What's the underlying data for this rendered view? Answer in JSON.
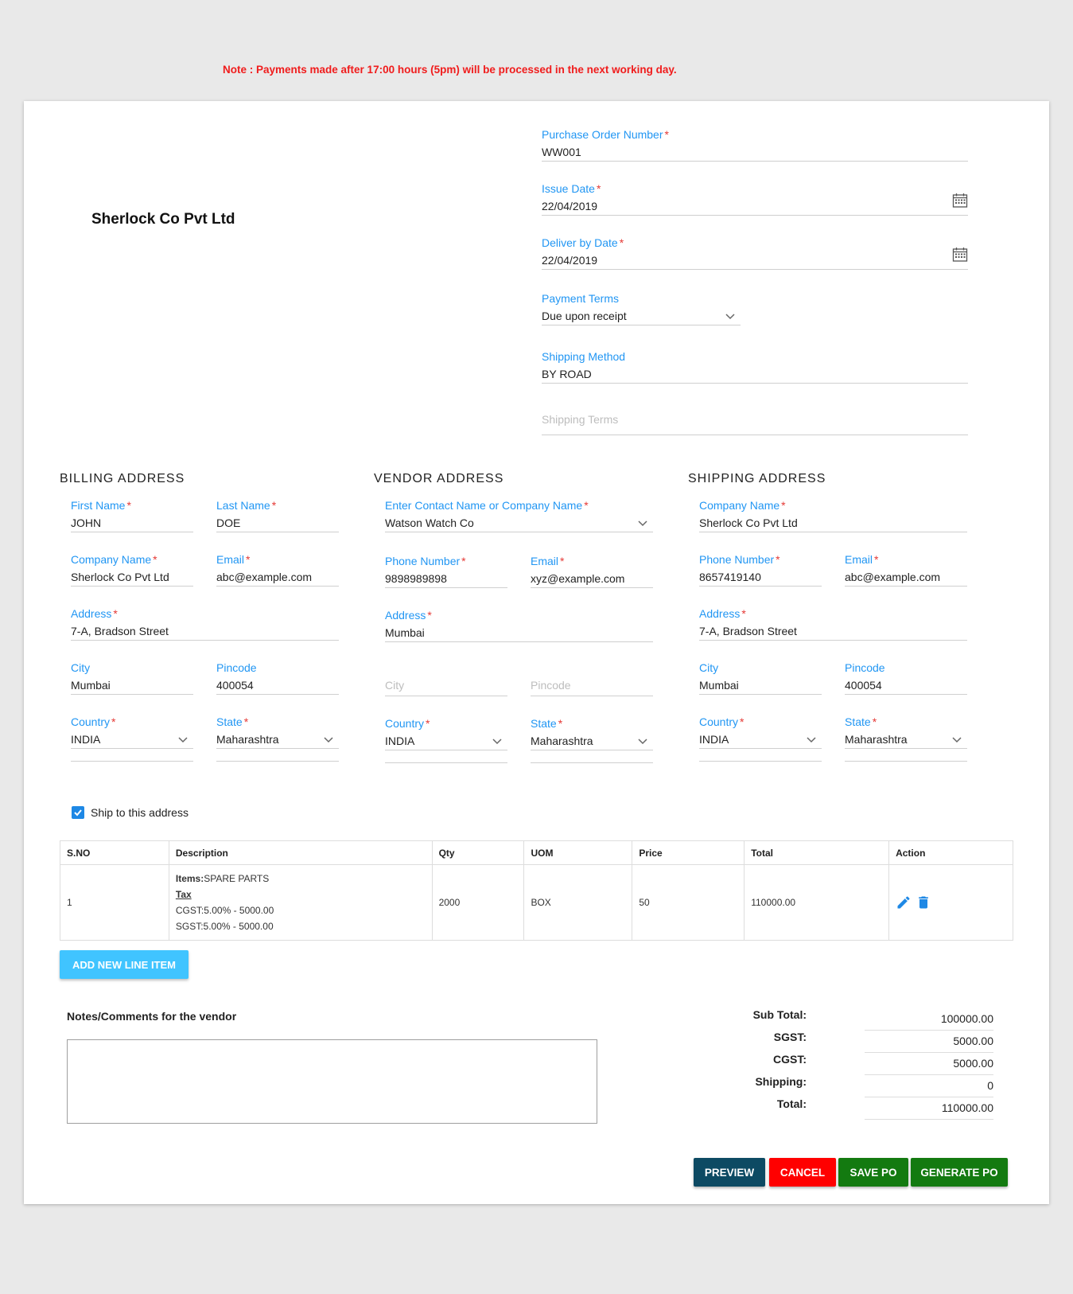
{
  "note": "Note : Payments made after 17:00 hours (5pm) will be processed in the next working day.",
  "company_name": "Sherlock Co Pvt Ltd",
  "po": {
    "po_number_label": "Purchase Order Number",
    "po_number": "WW001",
    "issue_date_label": "Issue Date",
    "issue_date": "22/04/2019",
    "deliver_label": "Deliver by Date",
    "deliver_date": "22/04/2019",
    "payment_terms_label": "Payment Terms",
    "payment_terms": "Due upon receipt",
    "shipping_method_label": "Shipping Method",
    "shipping_method": "BY ROAD",
    "shipping_terms_placeholder": "Shipping Terms"
  },
  "billing": {
    "title": "BILLING ADDRESS",
    "first_name_label": "First Name",
    "first_name": "JOHN",
    "last_name_label": "Last Name",
    "last_name": "DOE",
    "company_label": "Company Name",
    "company": "Sherlock Co Pvt Ltd",
    "email_label": "Email",
    "email": "abc@example.com",
    "address_label": "Address",
    "address": "7-A, Bradson Street",
    "city_label": "City",
    "city": "Mumbai",
    "pincode_label": "Pincode",
    "pincode": "400054",
    "country_label": "Country",
    "country": "INDIA",
    "state_label": "State",
    "state": "Maharashtra"
  },
  "vendor": {
    "title": "VENDOR ADDRESS",
    "contact_label": "Enter Contact Name or Company Name",
    "contact": "Watson Watch Co",
    "phone_label": "Phone Number",
    "phone": "9898989898",
    "email_label": "Email",
    "email": "xyz@example.com",
    "address_label": "Address",
    "address": "Mumbai",
    "city_placeholder": "City",
    "pincode_placeholder": "Pincode",
    "country_label": "Country",
    "country": "INDIA",
    "state_label": "State",
    "state": "Maharashtra"
  },
  "shipping": {
    "title": "SHIPPING ADDRESS",
    "company_label": "Company Name",
    "company": "Sherlock Co Pvt Ltd",
    "phone_label": "Phone Number",
    "phone": "8657419140",
    "email_label": "Email",
    "email": "abc@example.com",
    "address_label": "Address",
    "address": "7-A, Bradson Street",
    "city_label": "City",
    "city": "Mumbai",
    "pincode_label": "Pincode",
    "pincode": "400054",
    "country_label": "Country",
    "country": "INDIA",
    "state_label": "State",
    "state": "Maharashtra"
  },
  "ship_to_label": "Ship to this address",
  "table": {
    "headers": [
      "S.NO",
      "Description",
      "Qty",
      "UOM",
      "Price",
      "Total",
      "Action"
    ],
    "rows": [
      {
        "sno": "1",
        "items_label": "Items:",
        "items_value": "SPARE PARTS",
        "tax_label": "Tax",
        "cgst": "CGST:5.00% - 5000.00",
        "sgst": "SGST:5.00% - 5000.00",
        "qty": "2000",
        "uom": "BOX",
        "price": "50",
        "total": "110000.00"
      }
    ]
  },
  "add_line_label": "ADD NEW LINE ITEM",
  "notes_label": "Notes/Comments for the vendor",
  "totals": {
    "sub_total_label": "Sub Total:",
    "sub_total": "100000.00",
    "sgst_label": "SGST:",
    "sgst": "5000.00",
    "cgst_label": "CGST:",
    "cgst": "5000.00",
    "shipping_label": "Shipping:",
    "shipping": "0",
    "total_label": "Total:",
    "total": "110000.00"
  },
  "buttons": {
    "preview": "PREVIEW",
    "cancel": "CANCEL",
    "save": "SAVE PO",
    "generate": "GENERATE PO"
  },
  "colors": {
    "label_blue": "#2196f3",
    "required_red": "#e53935",
    "preview": "#0d4a63",
    "cancel": "#ff0000",
    "save": "#137a10",
    "generate": "#137a10",
    "add_button": "#40c4ff"
  }
}
